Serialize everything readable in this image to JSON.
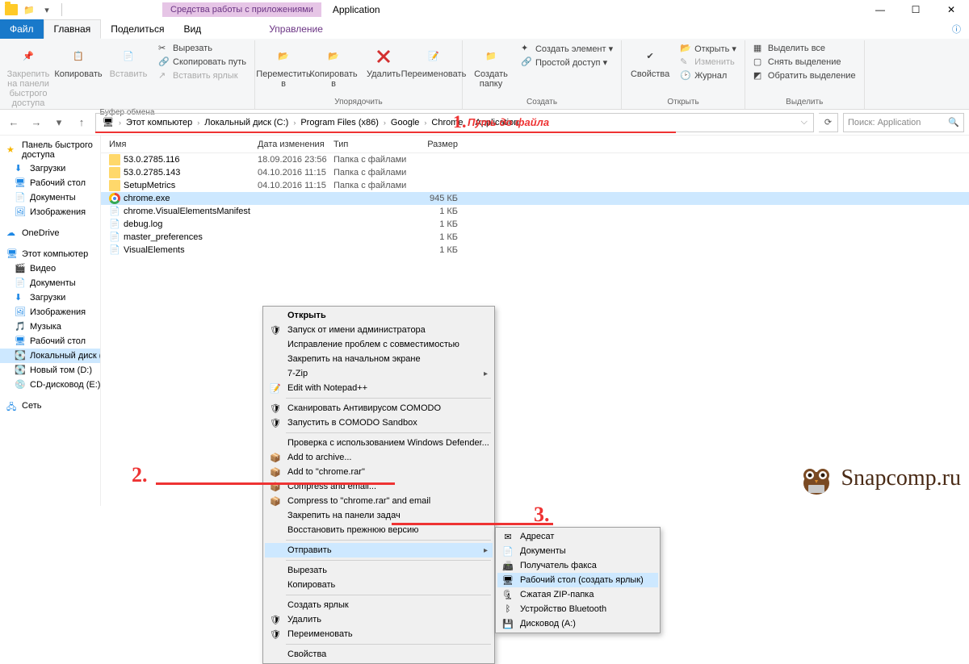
{
  "window": {
    "context_tab": "Средства работы с приложениями",
    "title": "Application",
    "tabs": {
      "file": "Файл",
      "home": "Главная",
      "share": "Поделиться",
      "view": "Вид",
      "manage": "Управление"
    }
  },
  "ribbon": {
    "clipboard": {
      "pin": "Закрепить на панели быстрого доступа",
      "copy": "Копировать",
      "paste": "Вставить",
      "cut": "Вырезать",
      "copy_path": "Скопировать путь",
      "paste_shortcut": "Вставить ярлык",
      "group": "Буфер обмена"
    },
    "organize": {
      "move": "Переместить в",
      "copy_to": "Копировать в",
      "delete": "Удалить",
      "rename": "Переименовать",
      "group": "Упорядочить"
    },
    "new": {
      "new_folder": "Создать папку",
      "new_item": "Создать элемент ▾",
      "easy_access": "Простой доступ ▾",
      "group": "Создать"
    },
    "open": {
      "properties": "Свойства",
      "open": "Открыть ▾",
      "edit": "Изменить",
      "history": "Журнал",
      "group": "Открыть"
    },
    "select": {
      "select_all": "Выделить все",
      "select_none": "Снять выделение",
      "invert": "Обратить выделение",
      "group": "Выделить"
    }
  },
  "breadcrumb": {
    "pc": "Этот компьютер",
    "c": "Локальный диск (C:)",
    "pf": "Program Files (x86)",
    "google": "Google",
    "chrome": "Chrome",
    "app": "Application"
  },
  "annotations": {
    "path": "Путь до файла",
    "n1": "1.",
    "n2": "2.",
    "n3": "3."
  },
  "search_placeholder": "Поиск: Application",
  "columns": {
    "name": "Имя",
    "date": "Дата изменения",
    "type": "Тип",
    "size": "Размер"
  },
  "sidebar": {
    "quick": "Панель быстрого доступа",
    "downloads": "Загрузки",
    "desktop": "Рабочий стол",
    "documents": "Документы",
    "pictures": "Изображения",
    "onedrive": "OneDrive",
    "thispc": "Этот компьютер",
    "video": "Видео",
    "documents2": "Документы",
    "downloads2": "Загрузки",
    "pictures2": "Изображения",
    "music": "Музыка",
    "desktop2": "Рабочий стол",
    "disk_c": "Локальный диск (C:)",
    "disk_d": "Новый том (D:)",
    "cd": "CD-дисковод (E:)",
    "network": "Сеть"
  },
  "files": [
    {
      "name": "53.0.2785.116",
      "date": "18.09.2016 23:56",
      "type": "Папка с файлами",
      "size": "",
      "icon": "folder"
    },
    {
      "name": "53.0.2785.143",
      "date": "04.10.2016 11:15",
      "type": "Папка с файлами",
      "size": "",
      "icon": "folder"
    },
    {
      "name": "SetupMetrics",
      "date": "04.10.2016 11:15",
      "type": "Папка с файлами",
      "size": "",
      "icon": "folder"
    },
    {
      "name": "chrome.exe",
      "date": "",
      "type": "",
      "size": "945 КБ",
      "icon": "chrome",
      "selected": true
    },
    {
      "name": "chrome.VisualElementsManifest",
      "date": "",
      "type": "",
      "size": "1 КБ",
      "icon": "file"
    },
    {
      "name": "debug.log",
      "date": "",
      "type": "",
      "size": "1 КБ",
      "icon": "file"
    },
    {
      "name": "master_preferences",
      "date": "",
      "type": "",
      "size": "1 КБ",
      "icon": "file"
    },
    {
      "name": "VisualElements",
      "date": "",
      "type": "",
      "size": "1 КБ",
      "icon": "file"
    }
  ],
  "ctx1": {
    "open": "Открыть",
    "runas": "Запуск от имени администратора",
    "compat": "Исправление проблем с совместимостью",
    "pinstart": "Закрепить на начальном экране",
    "sevenzip": "7-Zip",
    "npp": "Edit with Notepad++",
    "comodo_scan": "Сканировать Антивирусом COMODO",
    "comodo_sb": "Запустить в COMODO Sandbox",
    "defender": "Проверка с использованием Windows Defender...",
    "addarchive": "Add to archive...",
    "addchrome": "Add to \"chrome.rar\"",
    "compressemail": "Compress and email...",
    "compresschrome": "Compress to \"chrome.rar\" and email",
    "pintask": "Закрепить на панели задач",
    "restore": "Восстановить прежнюю версию",
    "sendto": "Отправить",
    "cut": "Вырезать",
    "copy": "Копировать",
    "shortcut": "Создать ярлык",
    "delete": "Удалить",
    "rename": "Переименовать",
    "props": "Свойства"
  },
  "ctx2": {
    "addr": "Адресат",
    "docs": "Документы",
    "fax": "Получатель факса",
    "desk": "Рабочий стол (создать ярлык)",
    "zip": "Сжатая ZIP-папка",
    "bt": "Устройство Bluetooth",
    "disk": "Дисковод (A:)"
  },
  "watermark": "Snapcomp.ru"
}
